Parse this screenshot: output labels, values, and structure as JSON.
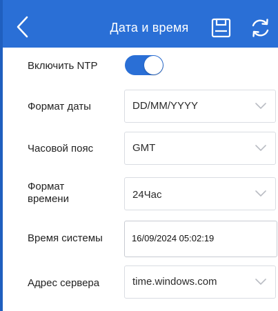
{
  "header": {
    "title": "Дата и время",
    "back_icon": "chevron-left-icon",
    "save_icon": "floppy-disk-icon",
    "refresh_icon": "refresh-icon"
  },
  "colors": {
    "primary": "#2a6fd6",
    "toggle_on": "#2a6fd6",
    "text": "#222222",
    "border": "#d9dce2"
  },
  "settings": {
    "ntp": {
      "label": "Включить NTP",
      "enabled": true
    },
    "date_format": {
      "label": "Формат даты",
      "value": "DD/MM/YYYY"
    },
    "time_zone": {
      "label": "Часовой пояс",
      "value": "GMT"
    },
    "time_format": {
      "label_line1": "Формат",
      "label_line2": "времени",
      "value": "24Час"
    },
    "system_time": {
      "label": "Время системы",
      "value": "16/09/2024 05:02:19"
    },
    "server_address": {
      "label": "Адрес сервера",
      "value": "time.windows.com"
    }
  }
}
